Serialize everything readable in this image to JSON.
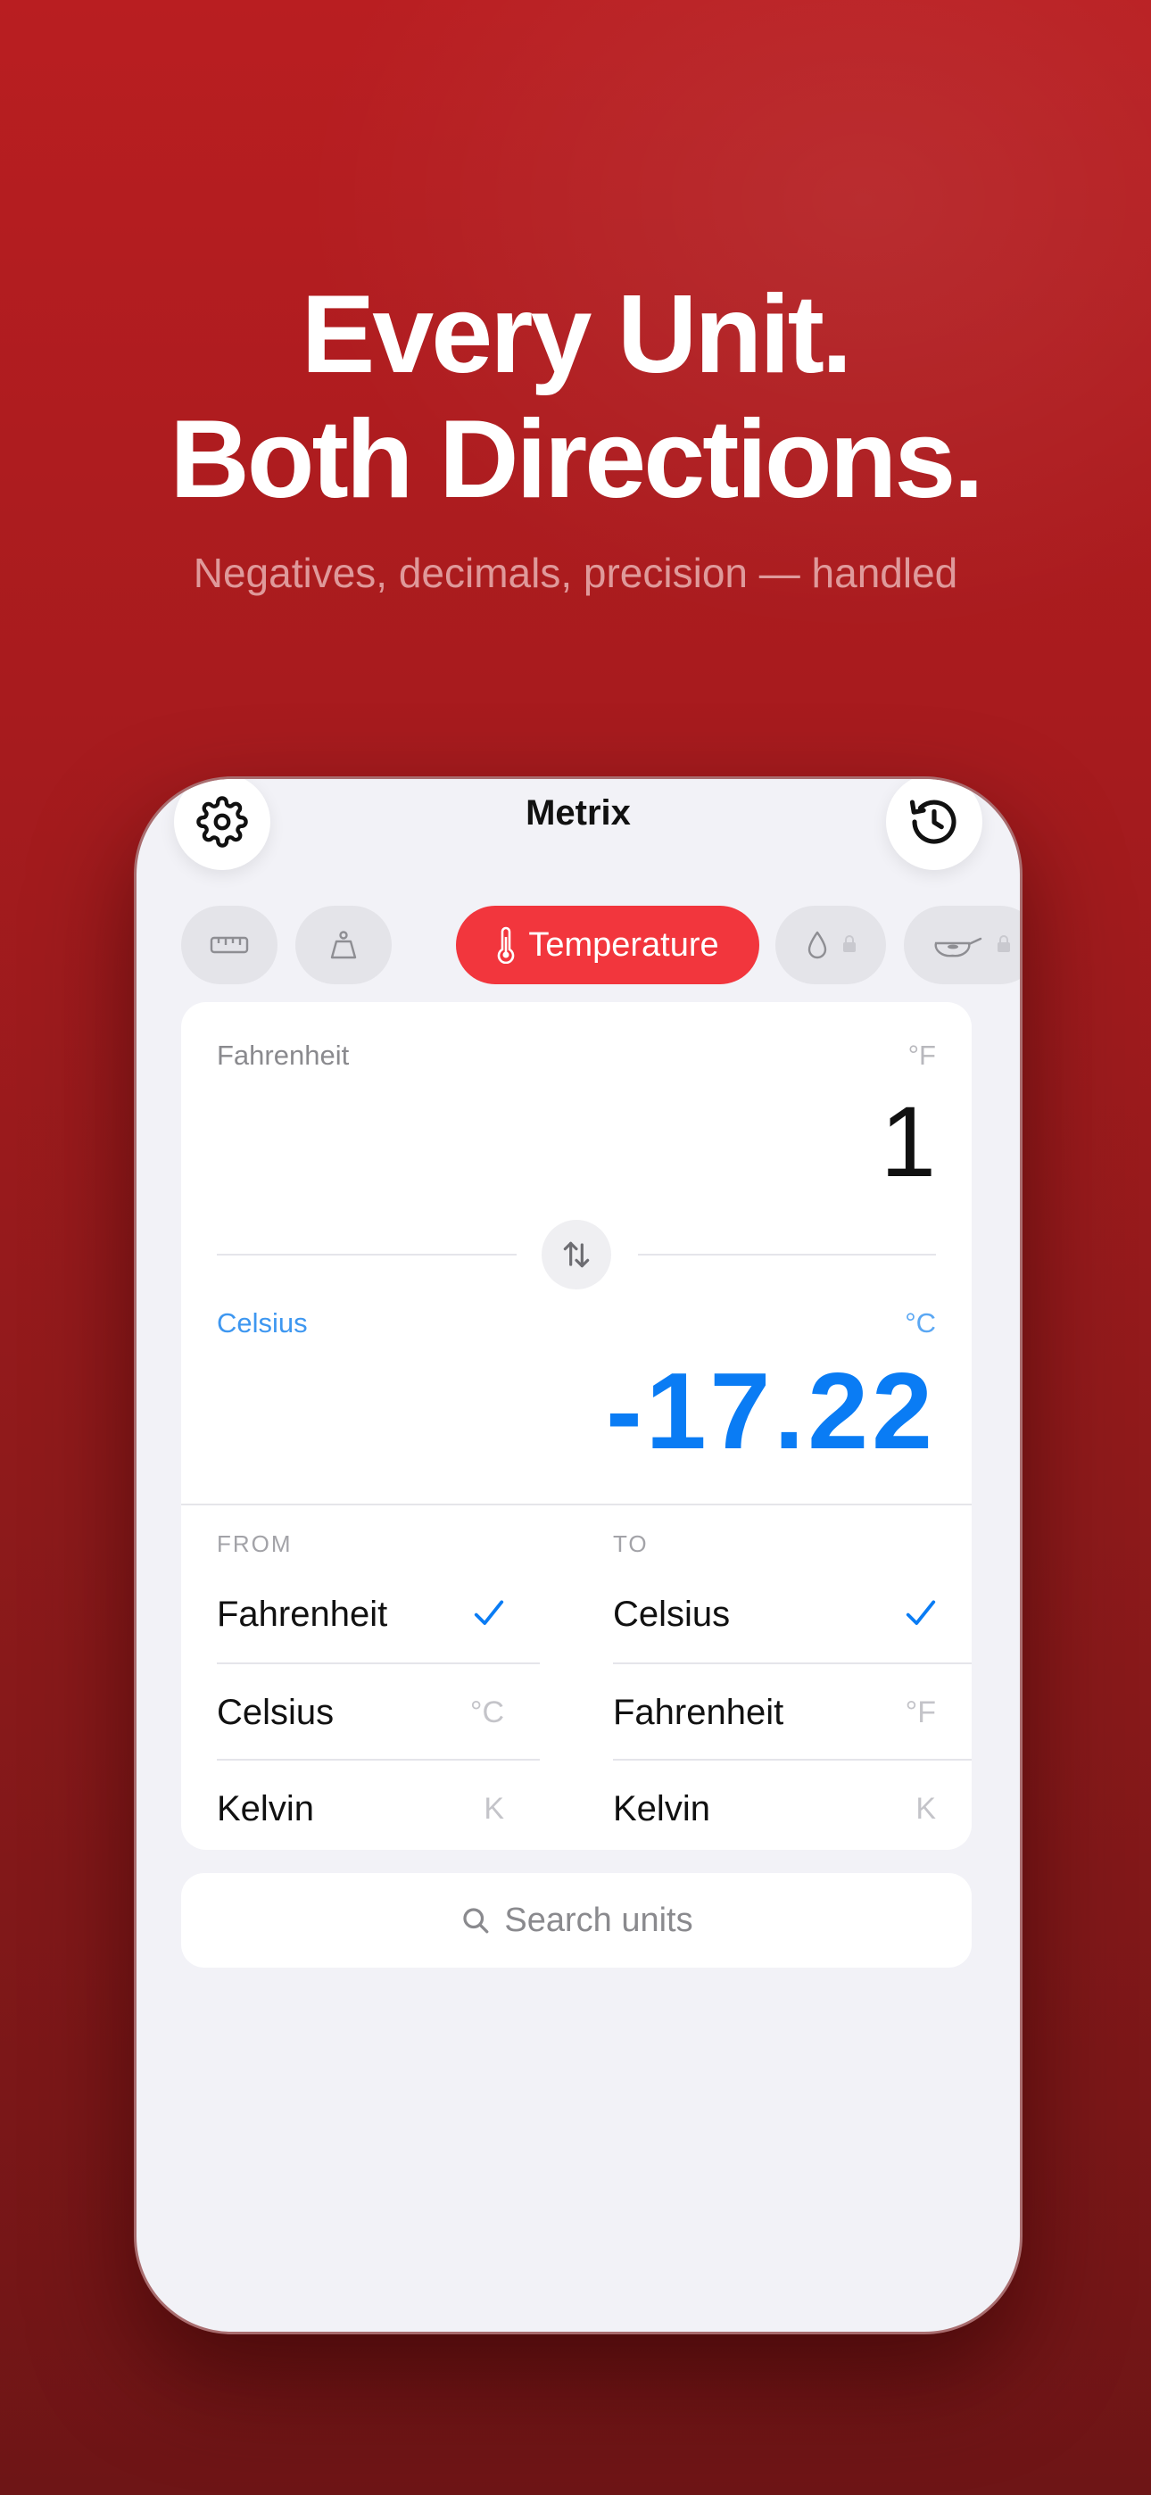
{
  "hero": {
    "title_line1": "Every Unit.",
    "title_line2": "Both Directions.",
    "subtitle": "Negatives, decimals, precision — handled"
  },
  "app": {
    "title": "Metrix",
    "icons": {
      "settings": "gear-icon",
      "history": "history-icon"
    }
  },
  "categories": [
    {
      "icon": "ruler-icon",
      "label": "",
      "locked": false
    },
    {
      "icon": "weight-icon",
      "label": "",
      "locked": false
    },
    {
      "icon": "thermometer-icon",
      "label": "Temperature",
      "locked": false,
      "selected": true
    },
    {
      "icon": "drop-icon",
      "label": "",
      "locked": true
    },
    {
      "icon": "pan-icon",
      "label": "",
      "locked": true
    }
  ],
  "converter": {
    "from_unit": "Fahrenheit",
    "from_symbol": "°F",
    "from_value": "1",
    "to_unit": "Celsius",
    "to_symbol": "°C",
    "to_value": "-17.22"
  },
  "picker": {
    "from_header": "FROM",
    "to_header": "TO",
    "from_options": [
      {
        "name": "Fahrenheit",
        "symbol": "°F",
        "selected": true
      },
      {
        "name": "Celsius",
        "symbol": "°C",
        "selected": false
      },
      {
        "name": "Kelvin",
        "symbol": "K",
        "selected": false
      }
    ],
    "to_options": [
      {
        "name": "Celsius",
        "symbol": "°C",
        "selected": true
      },
      {
        "name": "Fahrenheit",
        "symbol": "°F",
        "selected": false
      },
      {
        "name": "Kelvin",
        "symbol": "K",
        "selected": false
      }
    ]
  },
  "search": {
    "placeholder": "Search units"
  },
  "colors": {
    "accent_red": "#f2363d",
    "accent_blue": "#0a7cf4",
    "background_red": "#a81b1e"
  }
}
